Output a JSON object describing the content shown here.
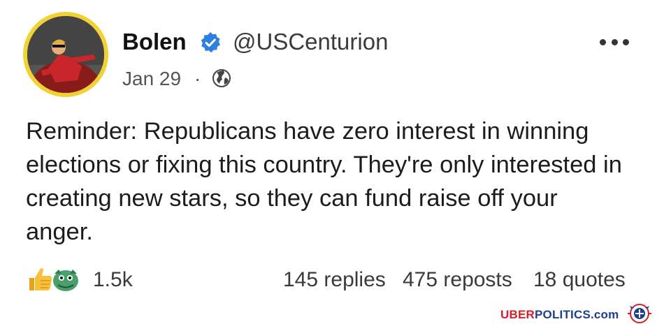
{
  "post": {
    "author": {
      "display_name": "Bolen",
      "handle": "@USCenturion",
      "verified": true,
      "avatar_icon": "profile-photo"
    },
    "meta": {
      "date": "Jan 29",
      "separator": "·",
      "visibility_icon": "globe-icon"
    },
    "more_icon": "more-options-icon",
    "text": "Reminder: Republicans have zero interest in winning elections or fixing this country. They're only interested in creating new stars, so they can fund raise off your anger.",
    "engagement": {
      "reaction_icons": [
        "thumbs-up-icon",
        "green-reaction-icon"
      ],
      "reactions_count": "1.5k",
      "replies": "145 replies",
      "reposts": "475 reposts",
      "quotes": "18 quotes"
    }
  },
  "watermark": {
    "uber": "UBER",
    "politics": "POLITICS",
    "com": ".com"
  },
  "colors": {
    "avatar_ring": "#f2d232",
    "verified": "#2f7fe0",
    "watermark_red": "#d61f2c",
    "watermark_blue": "#1d3f8f"
  }
}
